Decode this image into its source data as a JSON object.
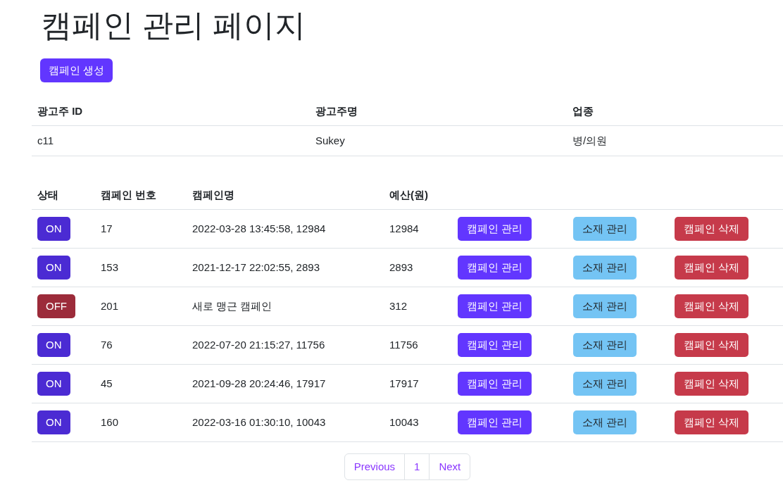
{
  "title": "캠페인 관리 페이지",
  "create_button": "캠페인 생성",
  "advertiser_table": {
    "columns": [
      "광고주 ID",
      "광고주명",
      "업종"
    ],
    "rows": [
      [
        "c11",
        "Sukey",
        "병/의원"
      ]
    ]
  },
  "campaign_table": {
    "columns": [
      "상태",
      "캠페인 번호",
      "캠페인명",
      "예산(원)"
    ],
    "rows": [
      {
        "status": {
          "label": "ON",
          "on": true
        },
        "number": "17",
        "name": "2022-03-28 13:45:58, 12984",
        "budget": "12984",
        "actions": [
          {
            "label": "캠페인 관리",
            "kind": "manage"
          },
          {
            "label": "소재 관리",
            "kind": "creative"
          },
          {
            "label": "캠페인 삭제",
            "kind": "delete"
          }
        ]
      },
      {
        "status": {
          "label": "ON",
          "on": true
        },
        "number": "153",
        "name": "2021-12-17 22:02:55, 2893",
        "budget": "2893",
        "actions": [
          {
            "label": "캠페인 관리",
            "kind": "manage"
          },
          {
            "label": "소재 관리",
            "kind": "creative"
          },
          {
            "label": "캠페인 삭제",
            "kind": "delete"
          }
        ]
      },
      {
        "status": {
          "label": "OFF",
          "on": false
        },
        "number": "201",
        "name": "새로 맹근 캠페인",
        "budget": "312",
        "actions": [
          {
            "label": "캠페인 관리",
            "kind": "manage"
          },
          {
            "label": "소재 관리",
            "kind": "creative"
          },
          {
            "label": "캠페인 삭제",
            "kind": "delete"
          }
        ]
      },
      {
        "status": {
          "label": "ON",
          "on": true
        },
        "number": "76",
        "name": "2022-07-20 21:15:27, 11756",
        "budget": "11756",
        "actions": [
          {
            "label": "캠페인 관리",
            "kind": "manage"
          },
          {
            "label": "소재 관리",
            "kind": "creative"
          },
          {
            "label": "캠페인 삭제",
            "kind": "delete"
          }
        ]
      },
      {
        "status": {
          "label": "ON",
          "on": true
        },
        "number": "45",
        "name": "2021-09-28 20:24:46, 17917",
        "budget": "17917",
        "actions": [
          {
            "label": "캠페인 관리",
            "kind": "manage"
          },
          {
            "label": "소재 관리",
            "kind": "creative"
          },
          {
            "label": "캠페인 삭제",
            "kind": "delete"
          }
        ]
      },
      {
        "status": {
          "label": "ON",
          "on": true
        },
        "number": "160",
        "name": "2022-03-16 01:30:10, 10043",
        "budget": "10043",
        "actions": [
          {
            "label": "캠페인 관리",
            "kind": "manage"
          },
          {
            "label": "소재 관리",
            "kind": "creative"
          },
          {
            "label": "캠페인 삭제",
            "kind": "delete"
          }
        ]
      }
    ]
  },
  "pagination": [
    "Previous",
    "1",
    "Next"
  ]
}
